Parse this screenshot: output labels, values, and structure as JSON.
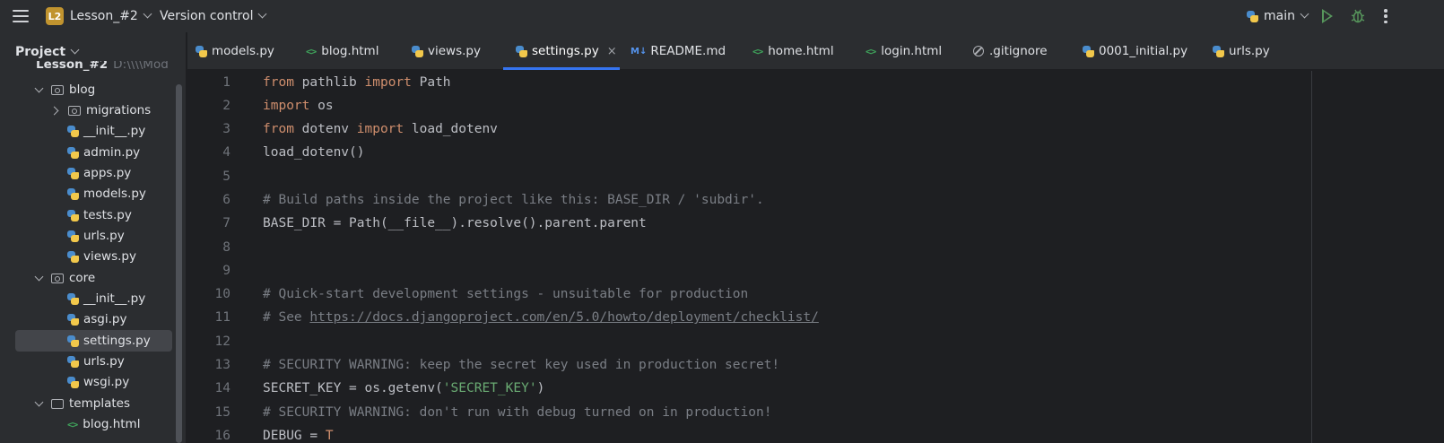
{
  "titlebar": {
    "project_badge": "L2",
    "project_name": "Lesson_#2",
    "version_control": "Version control",
    "branch": "main"
  },
  "sidebar": {
    "title": "Project",
    "root_label": "Lesson_#2",
    "root_path": "D:\\\\\\\\Mod",
    "items": [
      {
        "label": "blog"
      },
      {
        "label": "migrations"
      },
      {
        "label": "__init__.py"
      },
      {
        "label": "admin.py"
      },
      {
        "label": "apps.py"
      },
      {
        "label": "models.py"
      },
      {
        "label": "tests.py"
      },
      {
        "label": "urls.py"
      },
      {
        "label": "views.py"
      },
      {
        "label": "core"
      },
      {
        "label": "__init__.py"
      },
      {
        "label": "asgi.py"
      },
      {
        "label": "settings.py"
      },
      {
        "label": "urls.py"
      },
      {
        "label": "wsgi.py"
      },
      {
        "label": "templates"
      },
      {
        "label": "blog.html"
      }
    ]
  },
  "tabs": [
    {
      "label": "models.py"
    },
    {
      "label": "blog.html"
    },
    {
      "label": "views.py"
    },
    {
      "label": "settings.py"
    },
    {
      "label": "README.md"
    },
    {
      "label": "home.html"
    },
    {
      "label": "login.html"
    },
    {
      "label": ".gitignore"
    },
    {
      "label": "0001_initial.py"
    },
    {
      "label": "urls.py"
    }
  ],
  "tab_icons": {
    "md": "M↓",
    "html": "<>",
    "close": "×"
  },
  "editor": {
    "line_numbers": [
      "1",
      "2",
      "3",
      "4",
      "5",
      "6",
      "7",
      "8",
      "9",
      "10",
      "11",
      "12",
      "13",
      "14",
      "15",
      "16"
    ],
    "l1": {
      "a": "from",
      "b": " pathlib ",
      "c": "import",
      "d": " Path"
    },
    "l2": {
      "a": "import",
      "b": " os"
    },
    "l3": {
      "a": "from",
      "b": " dotenv ",
      "c": "import",
      "d": " load_dotenv"
    },
    "l4": "load_dotenv()",
    "l6": "# Build paths inside the project like this: BASE_DIR / 'subdir'.",
    "l7": "BASE_DIR = Path(__file__).resolve().parent.parent",
    "l10": "# Quick-start development settings - unsuitable for production",
    "l11": {
      "a": "# See ",
      "b": "https://docs.djangoproject.com/en/5.0/howto/deployment/checklist/"
    },
    "l13": "# SECURITY WARNING: keep the secret key used in production secret!",
    "l14": {
      "a": "SECRET_KEY = os.getenv(",
      "b": "'SECRET_KEY'",
      "c": ")"
    },
    "l15": "# SECURITY WARNING: don't run with debug turned on in production!",
    "l16": {
      "a": "DEBUG = ",
      "b": "T"
    }
  },
  "colors": {
    "keyword": "#cf8e6d",
    "comment": "#7a7e85",
    "string": "#6aab73",
    "accent": "#3574f0",
    "badge": "#c1942f",
    "run": "#57965c"
  }
}
